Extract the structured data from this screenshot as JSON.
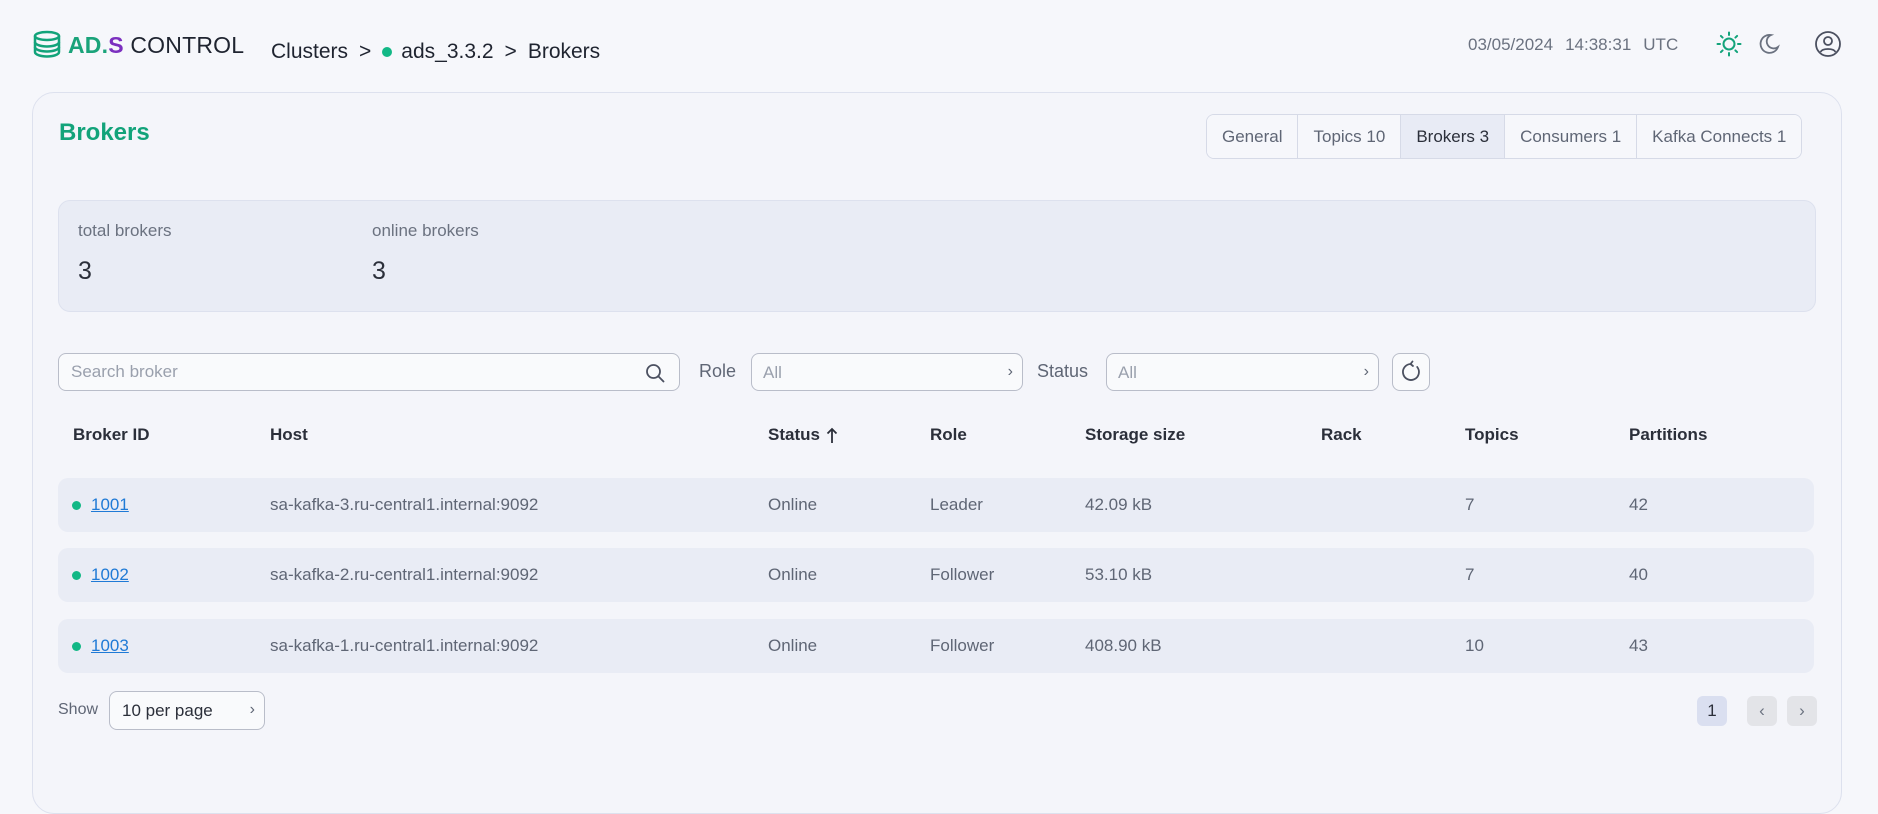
{
  "header": {
    "logo": {
      "ad": "AD.",
      "s": "S",
      "control": " CONTROL"
    },
    "breadcrumb": {
      "clusters": "Clusters",
      "sep": ">",
      "cluster": "ads_3.3.2",
      "current": "Brokers"
    },
    "date": "03/05/2024",
    "time": "14:38:31",
    "tz": "UTC",
    "icons": [
      "sun-icon",
      "moon-icon",
      "user-avatar-icon"
    ]
  },
  "page": {
    "title": "Brokers"
  },
  "tabs": [
    {
      "label": "General",
      "active": false
    },
    {
      "label": "Topics 10",
      "active": false
    },
    {
      "label": "Brokers 3",
      "active": true
    },
    {
      "label": "Consumers 1",
      "active": false
    },
    {
      "label": "Kafka Connects 1",
      "active": false
    }
  ],
  "stats": {
    "total": {
      "label": "total brokers",
      "value": "3"
    },
    "online": {
      "label": "online brokers",
      "value": "3"
    }
  },
  "filters": {
    "search_placeholder": "Search broker",
    "role_label": "Role",
    "role_value": "All",
    "status_label": "Status",
    "status_value": "All"
  },
  "table": {
    "headers": [
      "Broker ID",
      "Host",
      "Status",
      "Role",
      "Storage size",
      "Rack",
      "Topics",
      "Partitions"
    ],
    "rows": [
      {
        "id": "1001",
        "host": "sa-kafka-3.ru-central1.internal:9092",
        "status": "Online",
        "role": "Leader",
        "storage": "42.09 kB",
        "rack": "",
        "topics": "7",
        "partitions": "42"
      },
      {
        "id": "1002",
        "host": "sa-kafka-2.ru-central1.internal:9092",
        "status": "Online",
        "role": "Follower",
        "storage": "53.10 kB",
        "rack": "",
        "topics": "7",
        "partitions": "40"
      },
      {
        "id": "1003",
        "host": "sa-kafka-1.ru-central1.internal:9092",
        "status": "Online",
        "role": "Follower",
        "storage": "408.90 kB",
        "rack": "",
        "topics": "10",
        "partitions": "43"
      }
    ]
  },
  "footer": {
    "show_label": "Show",
    "per_page": "10 per page",
    "current_page": "1"
  },
  "colors": {
    "accent": "#12a37a",
    "online": "#12b886",
    "link": "#1f7ad6",
    "brand_s": "#7b2fbf"
  }
}
